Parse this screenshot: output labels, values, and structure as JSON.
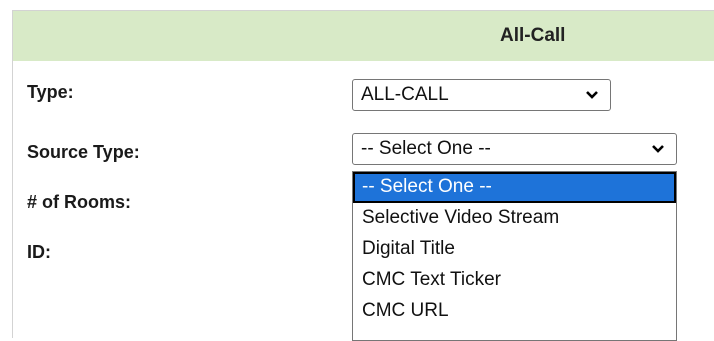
{
  "header": {
    "title": "All-Call"
  },
  "form": {
    "type_label": "Type:",
    "type_value": "ALL-CALL",
    "source_type_label": "Source Type:",
    "source_type_value": "-- Select One --",
    "rooms_label": "# of Rooms:",
    "id_label": "ID:"
  },
  "source_type_options": [
    "-- Select One --",
    "Selective Video Stream",
    "Digital Title",
    "CMC Text Ticker",
    "CMC URL"
  ],
  "colors": {
    "header_bg": "#d8eac7",
    "option_highlight": "#1e73d9"
  }
}
